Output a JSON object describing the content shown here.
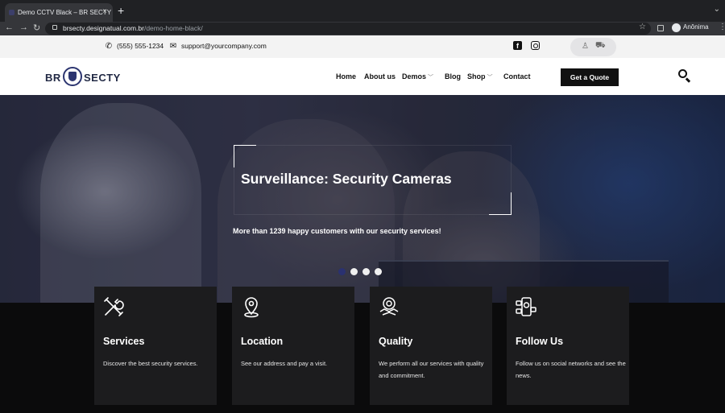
{
  "browser": {
    "tab_title": "Demo CCTV Black – BR SECTY",
    "tab_close": "×",
    "new_tab": "+",
    "tab_menu": "⌄",
    "url_host": "brsecty.designatual.com.br",
    "url_path": "/demo-home-black/",
    "profile_name": "Anônima",
    "back": "←",
    "forward": "→",
    "reload": "↻",
    "star": "☆",
    "kebab": "⋮"
  },
  "topbar": {
    "phone": "(555) 555-1234",
    "email": "support@yourcompany.com",
    "social": [
      "facebook-icon",
      "instagram-icon"
    ]
  },
  "header": {
    "logo_left": "BR",
    "logo_right": "SECTY",
    "nav": [
      {
        "label": "Home"
      },
      {
        "label": "About us"
      },
      {
        "label": "Demos",
        "has_dropdown": true
      },
      {
        "label": "Blog"
      },
      {
        "label": "Shop",
        "has_dropdown": true
      },
      {
        "label": "Contact"
      }
    ],
    "cta": "Get a Quote"
  },
  "hero": {
    "title": "Surveillance: Security Cameras",
    "subtitle": "More than 1239 happy customers with our security services!",
    "slides": 4,
    "active_slide": 1
  },
  "features": [
    {
      "icon": "tools-icon",
      "title": "Services",
      "description": "Discover the best security services."
    },
    {
      "icon": "location-pin-icon",
      "title": "Location",
      "description": "See our address and pay a visit."
    },
    {
      "icon": "quality-handshake-icon",
      "title": "Quality",
      "description": "We perform all our services with quality and commitment."
    },
    {
      "icon": "social-media-icon",
      "title": "Follow Us",
      "description": "Follow us on social networks and see the news."
    }
  ],
  "colors": {
    "brand": "#2c3570",
    "card_bg": "#1c1c1e",
    "page_bg": "#0b0b0c",
    "button": "#111111"
  }
}
